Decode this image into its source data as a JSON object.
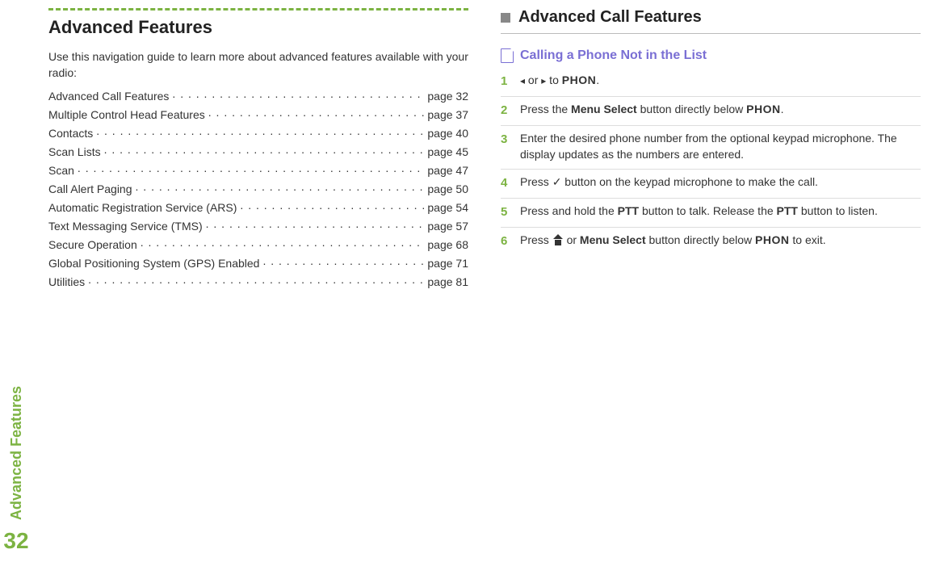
{
  "sidebar": {
    "label": "Advanced Features",
    "page_number": "32"
  },
  "left": {
    "title": "Advanced Features",
    "intro": "Use this navigation guide to learn more about advanced features available with your radio:",
    "toc": [
      {
        "label": "Advanced Call Features",
        "page": "page 32"
      },
      {
        "label": "Multiple Control Head Features",
        "page": "page 37"
      },
      {
        "label": "Contacts",
        "page": "page 40"
      },
      {
        "label": "Scan Lists",
        "page": "page 45"
      },
      {
        "label": "Scan",
        "page": "page 47"
      },
      {
        "label": "Call Alert Paging",
        "page": "page 50"
      },
      {
        "label": "Automatic Registration Service (ARS)",
        "page": "page 54"
      },
      {
        "label": "Text Messaging Service (TMS)",
        "page": "page 57"
      },
      {
        "label": "Secure Operation",
        "page": "page 68"
      },
      {
        "label": "Global Positioning System (GPS) Enabled",
        "page": "page 71"
      },
      {
        "label": "Utilities",
        "page": "page 81"
      }
    ]
  },
  "right": {
    "title": "Advanced Call Features",
    "sub_title": "Calling a Phone Not in the List",
    "steps": {
      "s1": {
        "num": "1",
        "or": " or ",
        "to": " to ",
        "phon": "PHON",
        "dot": "."
      },
      "s2": {
        "num": "2",
        "pre": "Press the ",
        "menu": "Menu Select",
        "mid": " button directly below ",
        "phon": "PHON",
        "dot": "."
      },
      "s3": {
        "num": "3",
        "text": "Enter the desired phone number from the optional keypad microphone. The display updates as the numbers are entered."
      },
      "s4": {
        "num": "4",
        "pre": "Press ",
        "check": "✓",
        "post": " button on the keypad microphone to make the call."
      },
      "s5": {
        "num": "5",
        "a": "Press and hold the ",
        "ptt1": "PTT",
        "b": " button to talk. Release the ",
        "ptt2": "PTT",
        "c": " button to listen."
      },
      "s6": {
        "num": "6",
        "pre": "Press ",
        "or": " or ",
        "menu": "Menu Select",
        "mid": " button directly below ",
        "phon": "PHON",
        "post": " to exit."
      }
    }
  }
}
